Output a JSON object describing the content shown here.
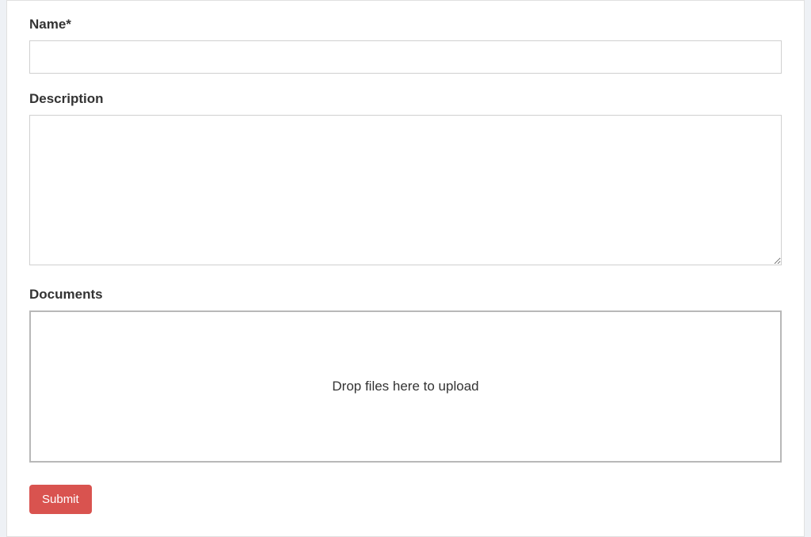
{
  "form": {
    "name": {
      "label": "Name*",
      "value": ""
    },
    "description": {
      "label": "Description",
      "value": ""
    },
    "documents": {
      "label": "Documents",
      "dropzone_text": "Drop files here to upload"
    },
    "submit_label": "Submit"
  }
}
